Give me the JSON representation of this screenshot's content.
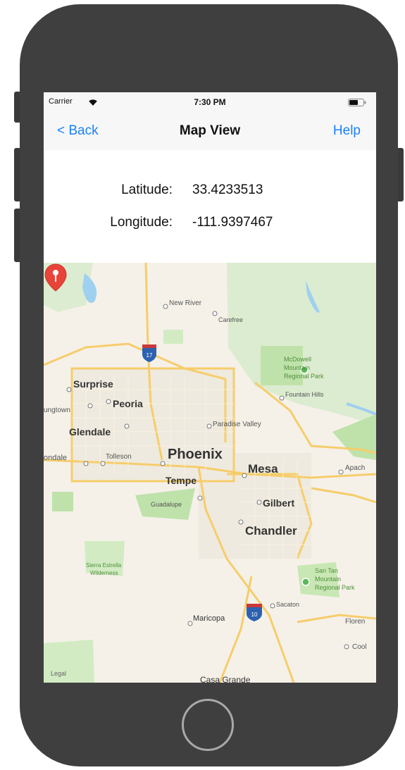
{
  "status_bar": {
    "carrier": "Carrier",
    "time": "7:30 PM",
    "wifi_icon": "wifi-icon",
    "battery_icon": "battery-icon"
  },
  "nav": {
    "back_label": "< Back",
    "title": "Map View",
    "help_label": "Help"
  },
  "location": {
    "latitude_label": "Latitude:",
    "latitude_value": "33.4233513",
    "longitude_label": "Longitude:",
    "longitude_value": "-111.9397467"
  },
  "map": {
    "pin_icon": "map-pin-icon",
    "legal_label": "Legal",
    "places": {
      "new_river": "New River",
      "carefree": "Carefree",
      "mcdowell": "McDowell",
      "mcdowell_2": "Mountain",
      "mcdowell_3": "Regional Park",
      "fountain_hills": "Fountain Hills",
      "surprise": "Surprise",
      "peoria": "Peoria",
      "youngtown": "ungtown",
      "glendale": "Glendale",
      "paradise_valley": "Paradise Valley",
      "avondale": "ondale",
      "tolleson": "Tolleson",
      "phoenix": "Phoenix",
      "mesa": "Mesa",
      "apache": "Apach",
      "tempe": "Tempe",
      "guadalupe": "Guadalupe",
      "gilbert": "Gilbert",
      "chandler": "Chandler",
      "sierra_estrella": "Sierra Estrella",
      "wilderness": "Wilderness",
      "san_tan": "San Tan",
      "san_tan_2": "Mountain",
      "san_tan_3": "Regional Park",
      "sacaton": "Sacaton",
      "maricopa": "Maricopa",
      "florence": "Floren",
      "coolidge": "Cool",
      "casa_grande": "Casa Grande"
    },
    "highways": {
      "i17": "17",
      "i10": "10"
    },
    "colors": {
      "land": "#f5f1e9",
      "park": "#c9e7b4",
      "water": "#9fd0ef",
      "road": "#f6cd6b",
      "pin": "#e8443a"
    }
  }
}
